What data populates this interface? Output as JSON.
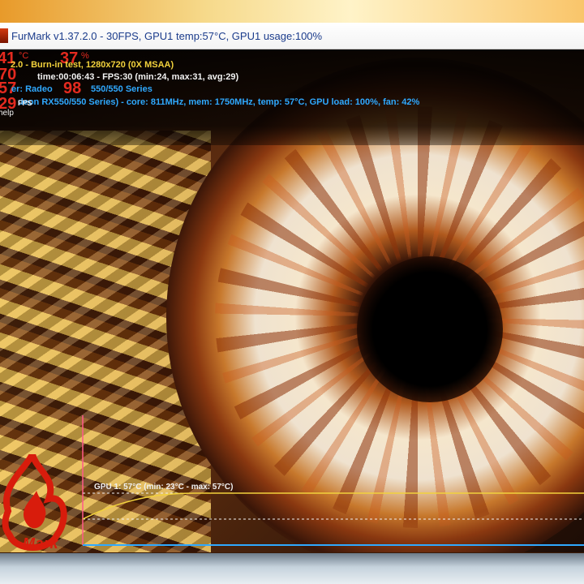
{
  "window": {
    "title": "FurMark v1.37.2.0 - 30FPS, GPU1 temp:57°C, GPU1 usage:100%"
  },
  "hud": {
    "temp_value": "41",
    "temp_unit": "°C",
    "usage_value": "37",
    "usage_unit": "%",
    "value_2": "70",
    "value_3": "57",
    "value_4": "98",
    "fps_value": "29",
    "fps_unit": "FPS",
    "line1": "2.0 - Burn-in test, 1280x720 (0X MSAA)",
    "line2": "time:00:06:43 - FPS:30 (min:24, max:31, avg:29)",
    "line3_prefix": "er: Radeo",
    "line3_suffix": "550/550 Series",
    "line4": "deon RX550/550 Series) - core: 811MHz, mem: 1750MHz, temp: 57°C, GPU load: 100%, fan: 42%",
    "help": "help"
  },
  "graph": {
    "label": "GPU 1: 57°C (min: 23°C - max: 57°C)",
    "temp_min": 23,
    "temp_max": 57,
    "temp_current": 57,
    "line_color": "#f2d23c",
    "axis_color": "#ff5a8a"
  },
  "logo": {
    "text": "Mark"
  },
  "colors": {
    "hud_red": "#e42a1f",
    "hud_yellow": "#f2d23c",
    "hud_cyan": "#2fa9ff",
    "title_blue": "#1b3c8c"
  }
}
